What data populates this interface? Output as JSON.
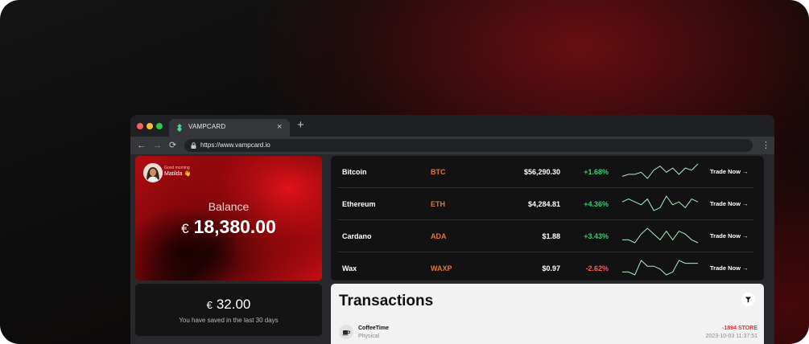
{
  "browser": {
    "tab_title": "VAMPCARD",
    "url": "https://www.vampcard.io",
    "new_tab_symbol": "+",
    "close_symbol": "×"
  },
  "colors": {
    "accent_red": "#c30f14",
    "positive": "#2fd26e",
    "negative": "#ff5a5f",
    "symbol_orange": "#e0773a"
  },
  "profile": {
    "greeting": "Good morning",
    "name": "Matilda 👋"
  },
  "balance": {
    "label": "Balance",
    "currency": "€",
    "amount": "18,380.00"
  },
  "savings": {
    "currency": "€",
    "amount": "32.00",
    "caption": "You have saved in the last 30 days"
  },
  "crypto": {
    "trade_label": "Trade Now",
    "rows": [
      {
        "name": "Bitcoin",
        "symbol": "BTC",
        "price": "$56,290.30",
        "change": "+1.68%",
        "trend": "up",
        "sparkline": [
          2,
          3,
          3,
          4,
          1,
          5,
          7,
          4,
          6,
          3,
          6,
          5,
          8
        ]
      },
      {
        "name": "Ethereum",
        "symbol": "ETH",
        "price": "$4,284.81",
        "change": "+4.36%",
        "trend": "up",
        "sparkline": [
          5,
          6,
          5,
          4,
          6,
          2,
          3,
          7,
          4,
          5,
          3,
          6,
          5
        ]
      },
      {
        "name": "Cardano",
        "symbol": "ADA",
        "price": "$1.88",
        "change": "+3.43%",
        "trend": "up",
        "sparkline": [
          3,
          3,
          2,
          5,
          7,
          5,
          3,
          6,
          3,
          6,
          5,
          3,
          2
        ]
      },
      {
        "name": "Wax",
        "symbol": "WAXP",
        "price": "$0.97",
        "change": "-2.62%",
        "trend": "down",
        "sparkline": [
          2,
          2,
          1,
          6,
          4,
          4,
          3,
          1,
          2,
          6,
          5,
          5,
          5
        ]
      }
    ]
  },
  "transactions": {
    "title": "Transactions",
    "items": [
      {
        "merchant": "CoffeeTime",
        "type": "Physical",
        "amount": "-1894 STORE",
        "date": "2023-10-03 11:37:51"
      }
    ]
  }
}
